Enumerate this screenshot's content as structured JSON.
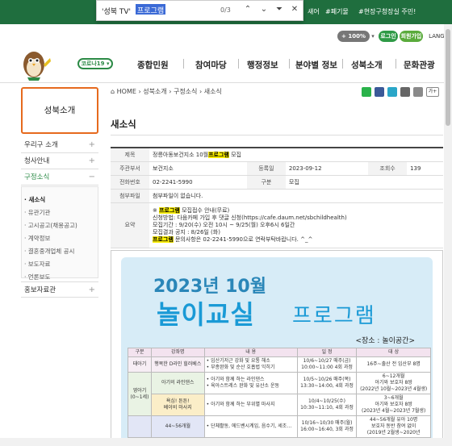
{
  "findbar": {
    "query_prefix": "'성북 TV'",
    "query": "프로그램",
    "count": "0/3",
    "up": "⌃",
    "down": "⌄",
    "filter": "⏷",
    "close": "✕"
  },
  "keywords": [
    "섀어",
    "#폐기물",
    "#현장구청장실 주민!"
  ],
  "util": {
    "zoom": "+ 100%",
    "zoom_arrow": "▾",
    "login": "로그인",
    "join": "회원가입",
    "lang": "LANGU"
  },
  "covid": "코로나19 ▾",
  "nav": [
    "종합민원",
    "참여마당",
    "행정정보",
    "분야별 정보",
    "성북소개",
    "문화관광"
  ],
  "sidebar": {
    "title": "성북소개",
    "items": [
      {
        "label": "우리구 소개",
        "toggle": "+"
      },
      {
        "label": "청사안내",
        "toggle": "+"
      },
      {
        "label": "구정소식",
        "toggle": "−"
      }
    ],
    "sub": [
      "새소식",
      "유관기관",
      "고시공고(채용공고)",
      "계약정보",
      "결혼중개업체 공시",
      "보도자료",
      "언론보도"
    ],
    "last": {
      "label": "홍보자료관",
      "toggle": "+"
    }
  },
  "breadcrumb": {
    "home": "HOME",
    "sep": "›",
    "path": [
      "성북소개",
      "구정소식",
      "새소식"
    ]
  },
  "share": [
    "blog",
    "print",
    "link"
  ],
  "page_title": "새소식",
  "post": {
    "labels": {
      "title": "제목",
      "dept": "주관부서",
      "date": "등록일",
      "views": "조회수",
      "tel": "전화번호",
      "type": "구분",
      "attach": "첨부파일",
      "summary": "요약"
    },
    "title_pre": "정릉아동보건지소 10월",
    "title_hl": "프로그램",
    "title_post": " 모집",
    "dept": "보건지소",
    "date": "2023-09-12",
    "views": "139",
    "tel": "02-2241-5990",
    "type": "모집",
    "attach": "첨부파일이 없습니다.",
    "summary": {
      "l1_pre": "※ ",
      "l1_hl": "프로그램",
      "l1_post": " 모집접수 안내(무료)",
      "l2": "신청방법: 다음카페 가입 후 댓글 신청(https://cafe.daum.net/sbchildhealth)",
      "l3": "모집기간 : 9/20(수) 오전 10시 ~ 9/25(월) 오후6시 6일간",
      "l4": "모집결과 공지 : 8/26일 (화)",
      "l5_hl": "프로그램",
      "l5_post": " 문의사항은 02-2241-5990으로 연락부탁바랍니다. ^_^"
    }
  },
  "poster": {
    "line1": "2023년 10월",
    "line2": "놀이교실",
    "line3": "프로그램",
    "place": "<장소 : 놀이공간>",
    "headers": [
      "구분",
      "강좌명",
      "내 용",
      "일 정",
      "대 상"
    ],
    "rows": [
      {
        "c1": "태아기",
        "c2": "행복한 D라인 힐러베스",
        "c3": "• 임산기저근 강화 및 요통 해소\n• 부종완화 및 순산 호흡법 익히기",
        "c4": "10/6~10/27 매주(금)\n10:00~11:00 4회 과정",
        "c5": "16주~출산 전 임산부 8명"
      },
      {
        "c1": "영아기\n(0~1세)",
        "c2": "아기의 라인댄스",
        "c3": "• 아기와 함께 하는 라인댄스\n• 육아스트레스 완화 및 유산소 운동",
        "c4": "10/5~10/26 매주(목)\n13:30~14:00, 4회 과정",
        "c5": "6~12개월\n아기와 보호자 8쌍\n(2022년 10월~2023년 4월생)"
      },
      {
        "c1": "",
        "c2": "욕심! 튼튼!\n베이비 마사지",
        "c3": "• 아기와 함께 하는 부위별 마사지",
        "c4": "10/4~10/25(수)\n10:30~11:10, 4회 과정",
        "c5": "3~6개월\n아기와 보호자 8쌍\n(2023년 4월~2023년 7월생)"
      },
      {
        "c1": "",
        "c2": "44~56개월",
        "c3": "• 단체활동, 에드벤시계임, 음수기, 세조…",
        "c4": "10/16~10/30 매주(월)\n16:00~16:40, 3회 과정",
        "c5": "44~56개월 유아 10명\n보호자 동반 참여 없이\n(2019년 2월생~2020년"
      }
    ]
  }
}
